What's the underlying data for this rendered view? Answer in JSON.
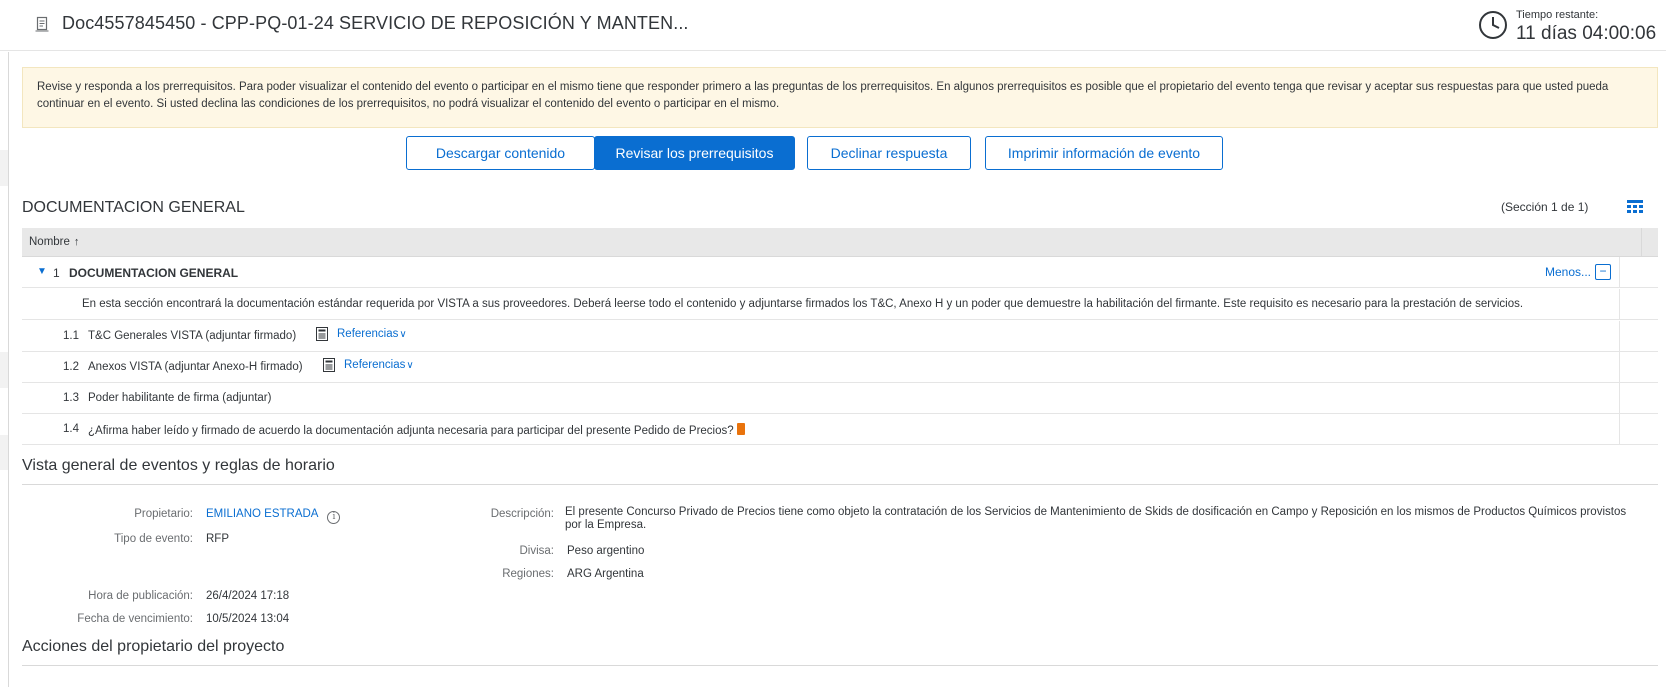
{
  "header": {
    "title": "Doc4557845450 - CPP-PQ-01-24 SERVICIO DE REPOSICIÓN Y MANTEN...",
    "time_label": "Tiempo restante:",
    "time_value": "11 días 04:00:06"
  },
  "notice": {
    "text": "Revise y responda a los prerrequisitos. Para poder visualizar el contenido del evento o participar en el mismo tiene que responder primero a las preguntas de los prerrequisitos. En algunos prerrequisitos es posible que el propietario del evento tenga que revisar y aceptar sus respuestas para que usted pueda continuar en el evento. Si usted declina las condiciones de los prerrequisitos, no podrá visualizar el contenido del evento o participar en el mismo."
  },
  "actions": {
    "download": "Descargar contenido",
    "review": "Revisar los prerrequisitos",
    "decline": "Declinar respuesta",
    "print": "Imprimir información de evento"
  },
  "section": {
    "title": "DOCUMENTACION GENERAL",
    "count": "(Sección 1 de 1)"
  },
  "table": {
    "column_name": "Nombre",
    "sort_icon": "↑",
    "group": {
      "toggle": "▼",
      "number": "1",
      "title": "DOCUMENTACION GENERAL",
      "less": "Menos...",
      "minus": "−",
      "description": "En esta sección encontrará la documentación estándar requerida por VISTA a sus proveedores. Deberá leerse todo el contenido y adjuntarse firmados los T&C, Anexo H y un poder que demuestre la habilitación del firmante. Este requisito es necesario para la prestación de servicios."
    },
    "items": [
      {
        "number": "1.1",
        "label": "T&C Generales VISTA (adjuntar firmado)",
        "ref": "Referencias"
      },
      {
        "number": "1.2",
        "label": "Anexos VISTA (adjuntar Anexo-H firmado)",
        "ref": "Referencias"
      },
      {
        "number": "1.3",
        "label": "Poder habilitante de firma (adjuntar)"
      },
      {
        "number": "1.4",
        "label": "¿Afirma haber leído y firmado de acuerdo la documentación adjunta necesaria para participar del presente Pedido de Precios?"
      }
    ],
    "chevron": "∨"
  },
  "overview": {
    "title": "Vista general de eventos y reglas de horario",
    "owner_label": "Propietario:",
    "owner_value": "EMILIANO ESTRADA",
    "event_type_label": "Tipo de evento:",
    "event_type_value": "RFP",
    "publish_label": "Hora de publicación:",
    "publish_value": "26/4/2024 17:18",
    "due_label": "Fecha de vencimiento:",
    "due_value": "10/5/2024 13:04",
    "description_label": "Descripción:",
    "description_value": "El presente Concurso Privado de Precios tiene como objeto la contratación de los Servicios de Mantenimiento de Skids de dosificación en Campo y Reposición en los mismos de Productos Químicos provistos por la Empresa.",
    "currency_label": "Divisa:",
    "currency_value": "Peso argentino",
    "regions_label": "Regiones:",
    "regions_value": "ARG Argentina",
    "info_icon": "i"
  },
  "owner_actions": {
    "title": "Acciones del propietario del proyecto"
  },
  "colors": {
    "accent": "#0a6ed1",
    "notice_bg": "#fef7e5",
    "warning": "#e9730c"
  }
}
